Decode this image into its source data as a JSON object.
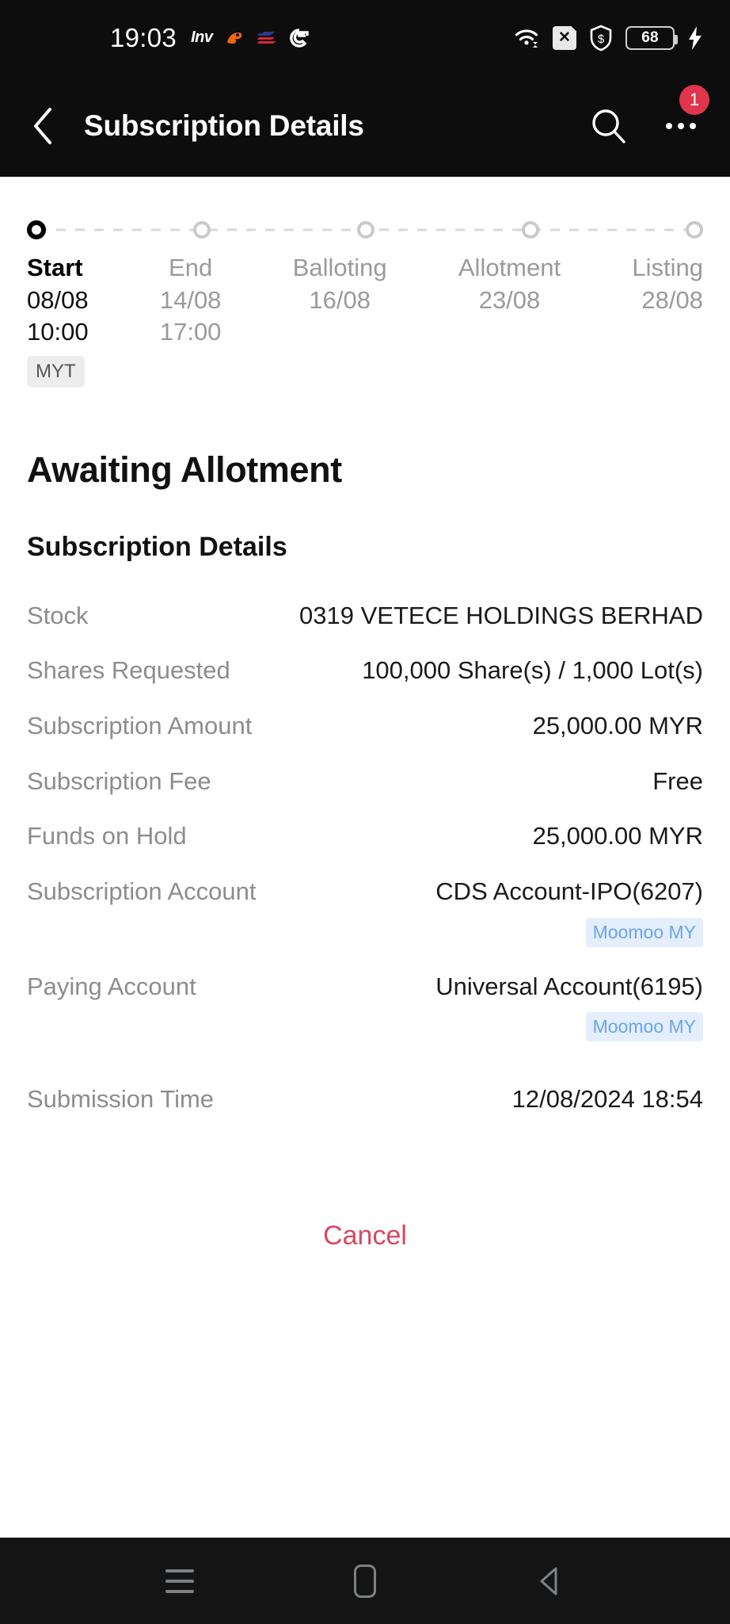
{
  "statusbar": {
    "time": "19:03",
    "app_icons": [
      {
        "name": "inv-app-icon",
        "label": "Inv"
      },
      {
        "name": "shopee-app-icon",
        "label": ""
      },
      {
        "name": "bank-app-icon",
        "label": ""
      },
      {
        "name": "google-app-icon",
        "label": "G"
      }
    ],
    "wifi_icon": "wifi-icon",
    "sim_icon": "sim-card-x-icon",
    "vpn_icon": "shield-dollar-icon",
    "battery_percent": "68",
    "charging_icon": "bolt-icon"
  },
  "appbar": {
    "back_icon": "chevron-left-icon",
    "title": "Subscription Details",
    "search_icon": "search-icon",
    "more_icon": "more-options-icon",
    "notification_count": "1"
  },
  "timeline": {
    "timezone_badge": "MYT",
    "steps": [
      {
        "name": "Start",
        "date": "08/08",
        "time": "10:00",
        "active": true
      },
      {
        "name": "End",
        "date": "14/08",
        "time": "17:00",
        "active": false
      },
      {
        "name": "Balloting",
        "date": "16/08",
        "time": "",
        "active": false
      },
      {
        "name": "Allotment",
        "date": "23/08",
        "time": "",
        "active": false
      },
      {
        "name": "Listing",
        "date": "28/08",
        "time": "",
        "active": false
      }
    ]
  },
  "main": {
    "status_heading": "Awaiting Allotment",
    "section_heading": "Subscription Details",
    "rows": [
      {
        "label": "Stock",
        "value": "0319 VETECE HOLDINGS BERHAD",
        "badge": ""
      },
      {
        "label": "Shares Requested",
        "value": "100,000 Share(s) / 1,000 Lot(s)",
        "badge": ""
      },
      {
        "label": "Subscription Amount",
        "value": "25,000.00 MYR",
        "badge": ""
      },
      {
        "label": "Subscription Fee",
        "value": "Free",
        "badge": ""
      },
      {
        "label": "Funds on Hold",
        "value": "25,000.00 MYR",
        "badge": ""
      },
      {
        "label": "Subscription Account",
        "value": "CDS Account-IPO(6207)",
        "badge": "Moomoo MY"
      },
      {
        "label": "Paying Account",
        "value": "Universal Account(6195)",
        "badge": "Moomoo MY"
      },
      {
        "label": "Submission Time",
        "value": "12/08/2024 18:54",
        "badge": ""
      }
    ],
    "cancel_label": "Cancel"
  },
  "navbar": {
    "recents_icon": "recents-icon",
    "home_icon": "home-icon",
    "back_icon": "back-triangle-icon"
  },
  "colors": {
    "header_bg": "#0d0d0d",
    "badge_red": "#e0354c",
    "cancel_red": "#d9475f",
    "account_badge_bg": "#e4eefc",
    "account_badge_text": "#6ba4ec",
    "label_gray": "#8d8d8d",
    "timeline_inactive": "#9a9a9a"
  }
}
